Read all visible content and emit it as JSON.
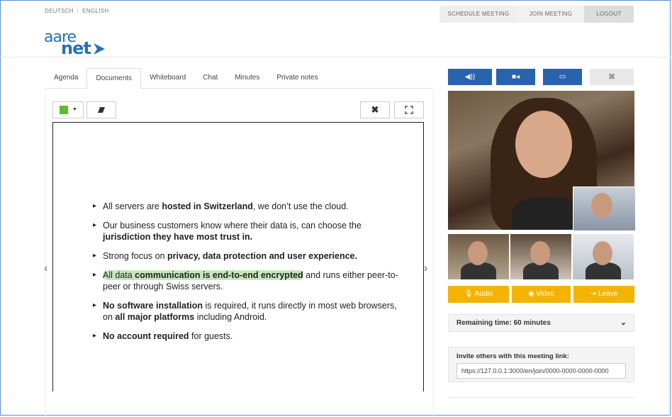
{
  "lang": {
    "de": "DEUTSCH",
    "en": "ENGLISH"
  },
  "topnav": {
    "schedule": "SCHEDULE MEETING",
    "join": "JOIN MEETING",
    "logout": "LOGOUT"
  },
  "logo": {
    "line1": "aare",
    "line2": "net"
  },
  "tabs": [
    "Agenda",
    "Documents",
    "Whiteboard",
    "Chat",
    "Minutes",
    "Private notes"
  ],
  "active_tab": "Documents",
  "toolbar": {
    "close_glyph": "✖",
    "fullscreen_glyph": "⛶",
    "pen_color": "#5cbd2a"
  },
  "slide": {
    "b1_pre": "All servers are ",
    "b1_bold": "hosted in Switzerland",
    "b1_post": ", we don’t use the cloud.",
    "b2_pre": "Our business customers know where their data is, can choose the ",
    "b2_bold": "jurisdiction they have most trust in.",
    "b3_pre": "Strong focus on ",
    "b3_bold": "privacy, data protection and user experience.",
    "b4_pre": "All data ",
    "b4_bold": "communication is end-to-end encrypted",
    "b4_post": " and runs either peer-to-peer or through Swiss servers.",
    "b5_bold": "No software installation",
    "b5_mid": " is required, it runs directly in most web browsers, on ",
    "b5_bold2": "all major platforms",
    "b5_post": " including Android.",
    "b6_bold": "No account required",
    "b6_post": " for guests."
  },
  "media_buttons": {
    "audio": "◀))",
    "video": "■◂",
    "screen": "▭",
    "close": "✖"
  },
  "actions": {
    "audio": "🎙 Audio",
    "video": "◉ Video",
    "leave": "⇥ Leave"
  },
  "remaining": "Remaining time: 60 minutes",
  "invite": {
    "label": "Invite others with this meeting link:",
    "url": "https://127.0.0.1:3000/en/join/0000-0000-0000-0000"
  },
  "colors": {
    "accent_blue": "#2a63ad",
    "action_yellow": "#f2b400"
  }
}
